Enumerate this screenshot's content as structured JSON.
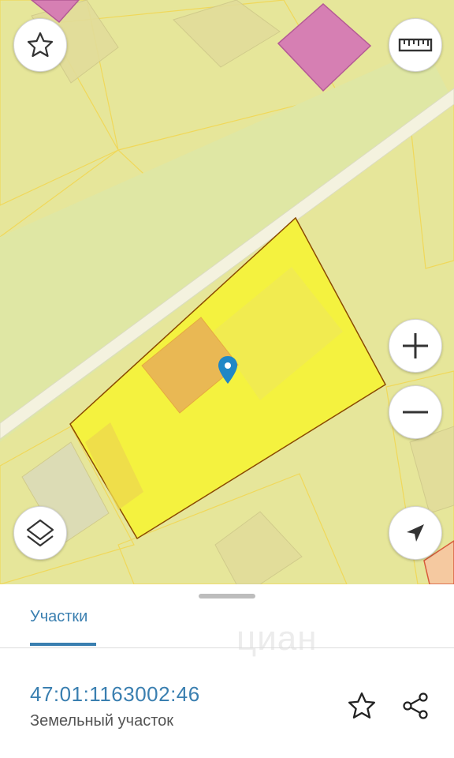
{
  "map": {
    "icons": {
      "favorite": "star-outline-icon",
      "ruler": "ruler-icon",
      "zoom_in": "plus-icon",
      "zoom_out": "minus-icon",
      "layers": "layers-icon",
      "locate": "navigation-arrow-icon",
      "marker": "map-pin-icon"
    },
    "colors": {
      "background": "#e6e69a",
      "road": "#f4f2df",
      "selected_parcel": "#f4f23f",
      "building_pink": "#d67fb3",
      "building_orange": "#e9b556",
      "marker": "#1f87c6"
    }
  },
  "sheet": {
    "tab_label": "Участки",
    "watermark": "циан",
    "parcel": {
      "cadastral_number": "47:01:1163002:46",
      "type": "Земельный участок"
    },
    "actions": {
      "favorite_icon": "star-outline-icon",
      "share_icon": "share-icon"
    }
  }
}
